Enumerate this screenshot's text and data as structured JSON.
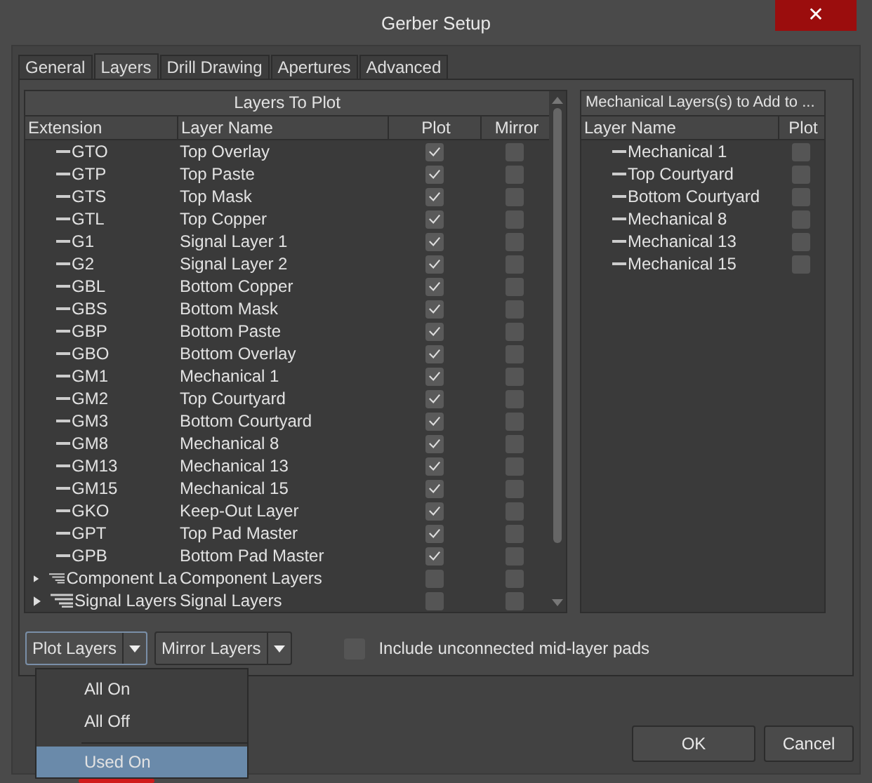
{
  "window": {
    "title": "Gerber Setup",
    "close": "✕"
  },
  "tabs": [
    {
      "label": "General",
      "selected": false
    },
    {
      "label": "Layers",
      "selected": true
    },
    {
      "label": "Drill Drawing",
      "selected": false
    },
    {
      "label": "Apertures",
      "selected": false
    },
    {
      "label": "Advanced",
      "selected": false
    }
  ],
  "layers_table": {
    "title": "Layers To Plot",
    "columns": [
      "Extension",
      "Layer Name",
      "Plot",
      "Mirror"
    ],
    "rows": [
      {
        "kind": "layer",
        "extension": "GTO",
        "name": "Top Overlay",
        "plot": true,
        "mirror": false
      },
      {
        "kind": "layer",
        "extension": "GTP",
        "name": "Top Paste",
        "plot": true,
        "mirror": false
      },
      {
        "kind": "layer",
        "extension": "GTS",
        "name": "Top Mask",
        "plot": true,
        "mirror": false
      },
      {
        "kind": "layer",
        "extension": "GTL",
        "name": "Top Copper",
        "plot": true,
        "mirror": false
      },
      {
        "kind": "layer",
        "extension": "G1",
        "name": "Signal Layer 1",
        "plot": true,
        "mirror": false
      },
      {
        "kind": "layer",
        "extension": "G2",
        "name": "Signal Layer 2",
        "plot": true,
        "mirror": false
      },
      {
        "kind": "layer",
        "extension": "GBL",
        "name": "Bottom Copper",
        "plot": true,
        "mirror": false
      },
      {
        "kind": "layer",
        "extension": "GBS",
        "name": "Bottom Mask",
        "plot": true,
        "mirror": false
      },
      {
        "kind": "layer",
        "extension": "GBP",
        "name": "Bottom Paste",
        "plot": true,
        "mirror": false
      },
      {
        "kind": "layer",
        "extension": "GBO",
        "name": "Bottom Overlay",
        "plot": true,
        "mirror": false
      },
      {
        "kind": "layer",
        "extension": "GM1",
        "name": "Mechanical 1",
        "plot": true,
        "mirror": false
      },
      {
        "kind": "layer",
        "extension": "GM2",
        "name": "Top Courtyard",
        "plot": true,
        "mirror": false
      },
      {
        "kind": "layer",
        "extension": "GM3",
        "name": "Bottom Courtyard",
        "plot": true,
        "mirror": false
      },
      {
        "kind": "layer",
        "extension": "GM8",
        "name": "Mechanical 8",
        "plot": true,
        "mirror": false
      },
      {
        "kind": "layer",
        "extension": "GM13",
        "name": "Mechanical 13",
        "plot": true,
        "mirror": false
      },
      {
        "kind": "layer",
        "extension": "GM15",
        "name": "Mechanical 15",
        "plot": true,
        "mirror": false
      },
      {
        "kind": "layer",
        "extension": "GKO",
        "name": "Keep-Out Layer",
        "plot": true,
        "mirror": false
      },
      {
        "kind": "layer",
        "extension": "GPT",
        "name": "Top Pad Master",
        "plot": true,
        "mirror": false
      },
      {
        "kind": "layer",
        "extension": "GPB",
        "name": "Bottom Pad Master",
        "plot": true,
        "mirror": false
      },
      {
        "kind": "group",
        "extension": "Component La",
        "name": "Component Layers",
        "plot": false,
        "mirror": false,
        "expanded": false
      },
      {
        "kind": "group",
        "extension": "Signal Layers",
        "name": "Signal Layers",
        "plot": false,
        "mirror": false,
        "expanded": false
      }
    ]
  },
  "mech_table": {
    "title": "Mechanical Layers(s) to Add to ...",
    "columns": [
      "Layer Name",
      "Plot"
    ],
    "rows": [
      {
        "name": "Mechanical 1",
        "plot": false
      },
      {
        "name": "Top Courtyard",
        "plot": false
      },
      {
        "name": "Bottom Courtyard",
        "plot": false
      },
      {
        "name": "Mechanical 8",
        "plot": false
      },
      {
        "name": "Mechanical 13",
        "plot": false
      },
      {
        "name": "Mechanical 15",
        "plot": false
      }
    ]
  },
  "plot_button": {
    "label": "Plot Layers",
    "open": true
  },
  "mirror_button": {
    "label": "Mirror Layers"
  },
  "include_pads": {
    "label": "Include unconnected mid-layer pads",
    "checked": false
  },
  "menu": [
    {
      "label": "All On",
      "selected": false,
      "marked": false
    },
    {
      "label": "All Off",
      "selected": false,
      "marked": false
    },
    {
      "label": "Used On",
      "selected": true,
      "marked": true
    }
  ],
  "buttons": [
    "OK",
    "Cancel"
  ]
}
